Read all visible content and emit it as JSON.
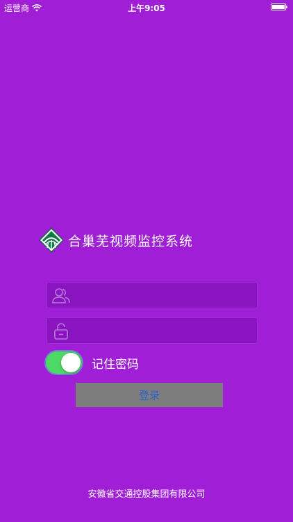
{
  "status_bar": {
    "carrier": "运营商",
    "time": "上午9:05"
  },
  "brand": {
    "title": "合巢芜视频监控系统"
  },
  "login_form": {
    "username": {
      "value": "",
      "placeholder": "",
      "icon": "users-icon"
    },
    "password": {
      "value": "",
      "placeholder": "",
      "icon": "lock-icon"
    },
    "remember": {
      "label": "记住密码",
      "on": true
    },
    "submit_label": "登录"
  },
  "footer": {
    "text": "安徽省交通控股集团有限公司"
  },
  "colors": {
    "background": "#a01fd6",
    "field": "#8a14bf",
    "toggle_on": "#4cd964",
    "button": "#7d7d7d",
    "button_text": "#2f61c8"
  }
}
